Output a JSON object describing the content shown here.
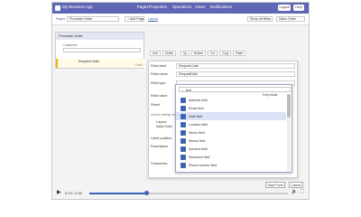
{
  "app": {
    "title": "My Business App"
  },
  "nav": {
    "items": [
      "Pages",
      "Properties",
      "Operations",
      "Views",
      "Notifications"
    ],
    "buttons": [
      "Logout",
      "Help"
    ]
  },
  "subheader": {
    "pages_label": "Pages",
    "page_select": "Purchase Order",
    "add_page": "+ Add Page",
    "layout_link": "Layout",
    "show_all": "Show all fields",
    "view_select": "Sales Order"
  },
  "left_panel": {
    "title": "Purchase Order",
    "field_label": "Customer",
    "required_text": "Required Date",
    "field_tag": "Field"
  },
  "toolbar": {
    "buttons": [
      "Add",
      "Delete",
      "Up",
      "Bottom",
      "Cut",
      "Copy",
      "Paste"
    ]
  },
  "dialog": {
    "fields": [
      {
        "label": "Field label",
        "value": "Request Date"
      },
      {
        "label": "Field name",
        "value": "RequestDate"
      },
      {
        "label": "Field type",
        "value": ""
      },
      {
        "label": "Field value",
        "value": ""
      },
      {
        "label": "Sheet",
        "value": ""
      },
      {
        "label": "Use the settings below",
        "value": ""
      },
      {
        "label": "Layout",
        "value": ""
      },
      {
        "label": "Label position",
        "value": ""
      },
      {
        "label": "Description",
        "value": ""
      },
      {
        "label": "Comments",
        "value": ""
      }
    ],
    "layout_option": "Sales Order",
    "search_value": "text",
    "entry_mode": "Entry Mode",
    "options": [
      "Address field",
      "Email field",
      "Date field",
      "Location field",
      "Memo field",
      "Money field",
      "Numeric field",
      "Password field",
      "Phone number field"
    ],
    "selected_index": 2
  },
  "footer": {
    "save": "Save Form",
    "cancel": "Cancel"
  },
  "player": {
    "time": "0:10 / 2:42",
    "progress": 0.29
  },
  "colors": {
    "accent": "#5f66b4",
    "icon": "#3c63b5",
    "selection": "#dde3f6"
  }
}
